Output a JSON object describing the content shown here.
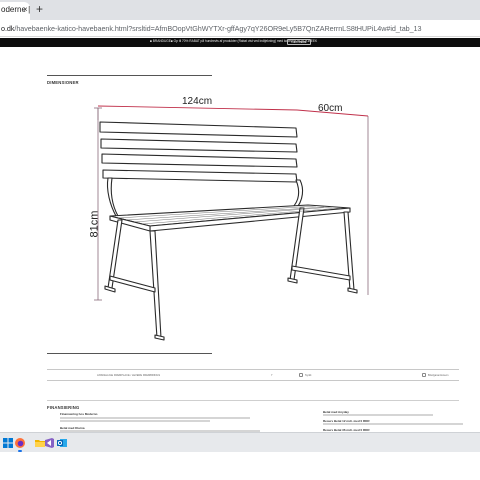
{
  "browser": {
    "tab_title": "oderne |",
    "tab_close": "×",
    "new_tab": "+",
    "url_host": "o.dk",
    "url_path": "/havebaenke-katico-havebaenk.html?srsltid=AfmBOopVtGhWYTXr-gffAgy7qY26OR9eLy5B7QnZARerrnLS8tHUPiL4w#id_tab_13"
  },
  "promo": {
    "text": "■ BRANDUGE■ Op til 70% RABAT på hundrevis af produkter (Rabat vist ved indtjekning) med kodeord: BLACKWEEK",
    "button": "LÆS MERE"
  },
  "dimensions": {
    "heading": "DIMENSIONER",
    "width_value": "124",
    "width_unit": "cm",
    "depth_value": "60",
    "depth_unit": "cm",
    "height_value": "81",
    "height_unit": "cm"
  },
  "info_bar": {
    "shipping": "ANSKELLIGE FREMPLACE / LEVERE FREMBRINGS",
    "count": "7",
    "item_a": "Synlit",
    "item_b": "Briefgarantioneon"
  },
  "financing": {
    "heading": "FINANSIERING",
    "sub": "Finansiering hos Moderno",
    "col1_a": "Betal med Klarna",
    "col1_b": "Resurs Betal 12 mdr. med 0 RDR",
    "col2_a": "Betal med Anyday",
    "col2_b": "Resurs Betal 12 mdr. med 0 RDR",
    "col2_c": "Resurs Betal 36 mdr. med 0 RDR"
  },
  "colors": {
    "accent_line": "#c0304a",
    "dim_line": "#8a6a7a",
    "promo_bg": "#0d0d0d",
    "taskbar_bg": "#e7e9ec"
  },
  "taskbar": {
    "icons": [
      "windows-start-icon",
      "firefox-icon",
      "folder-icon",
      "visual-studio-icon",
      "outlook-icon"
    ]
  }
}
